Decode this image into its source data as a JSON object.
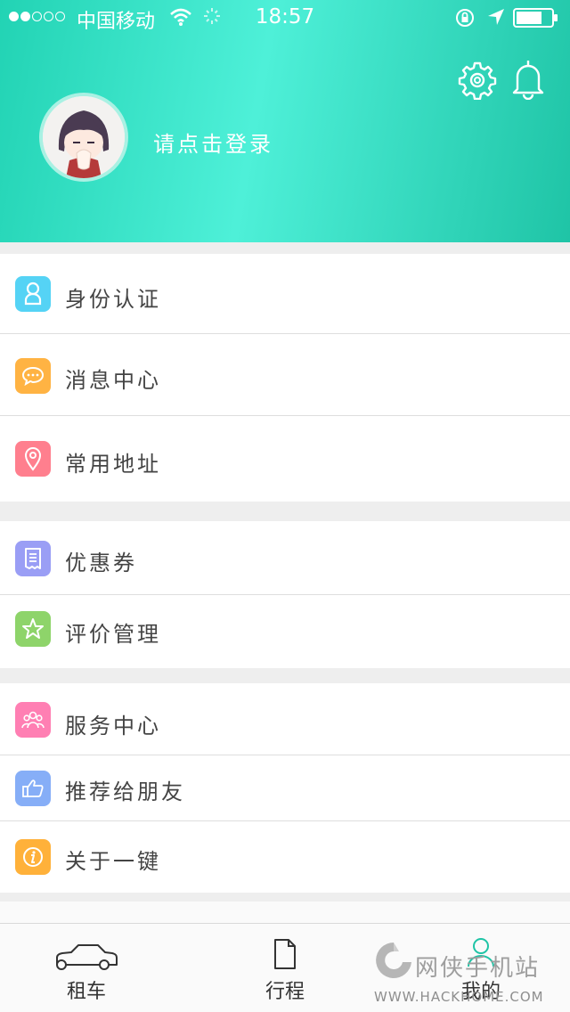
{
  "status_bar": {
    "carrier": "中国移动",
    "time": "18:57"
  },
  "header": {
    "login_prompt": "请点击登录",
    "icons": [
      "gear-icon",
      "bell-icon"
    ],
    "gradient_colors": [
      "#22d3b4",
      "#4ef0d8",
      "#1fc4a6"
    ]
  },
  "menu": {
    "group1": [
      {
        "label": "身份认证",
        "icon": "id-card-icon",
        "color": "#55d3f5"
      },
      {
        "label": "消息中心",
        "icon": "message-icon",
        "color": "#ffb343"
      },
      {
        "label": "常用地址",
        "icon": "location-pin-icon",
        "color": "#ff7f8e"
      }
    ],
    "group2": [
      {
        "label": "优惠券",
        "icon": "coupon-icon",
        "color": "#9a9ef5"
      },
      {
        "label": "评价管理",
        "icon": "star-icon",
        "color": "#8ed46a"
      }
    ],
    "group3": [
      {
        "label": "服务中心",
        "icon": "group-icon",
        "color": "#ff7fb3"
      },
      {
        "label": "推荐给朋友",
        "icon": "thumbs-up-icon",
        "color": "#86aef7"
      },
      {
        "label": "关于一键",
        "icon": "info-icon",
        "color": "#ffb13a"
      }
    ]
  },
  "tabbar": {
    "tabs": [
      {
        "label": "租车",
        "icon": "car-icon"
      },
      {
        "label": "行程",
        "icon": "document-icon"
      },
      {
        "label": "我的",
        "icon": "user-icon"
      }
    ]
  },
  "watermark": {
    "text": "网侠手机站",
    "url": "WWW.HACKHOME.COM"
  }
}
